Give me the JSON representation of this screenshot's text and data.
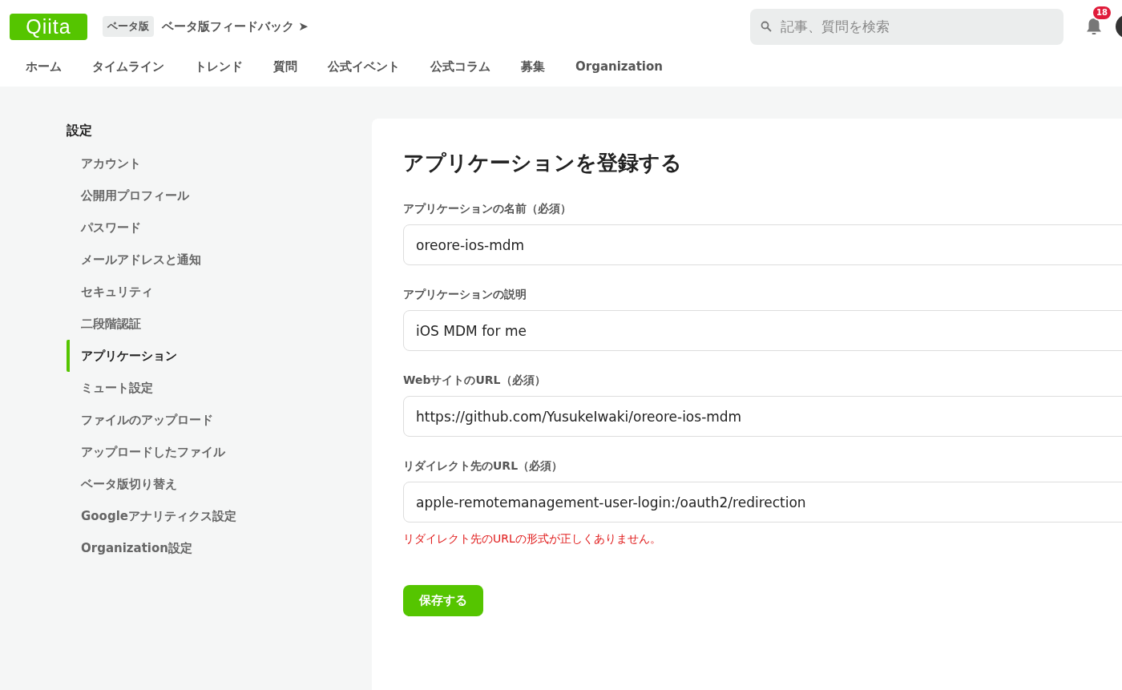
{
  "header": {
    "logo": "Qiita",
    "beta_badge": "ベータ版",
    "feedback_link": "ベータ版フィードバック",
    "feedback_arrow": "➤",
    "search": {
      "placeholder": "記事、質問を検索"
    },
    "notification_count": "18"
  },
  "nav": [
    "ホーム",
    "タイムライン",
    "トレンド",
    "質問",
    "公式イベント",
    "公式コラム",
    "募集",
    "Organization"
  ],
  "sidebar": {
    "title": "設定",
    "items": [
      {
        "label": "アカウント",
        "selected": false
      },
      {
        "label": "公開用プロフィール",
        "selected": false
      },
      {
        "label": "パスワード",
        "selected": false
      },
      {
        "label": "メールアドレスと通知",
        "selected": false
      },
      {
        "label": "セキュリティ",
        "selected": false
      },
      {
        "label": "二段階認証",
        "selected": false
      },
      {
        "label": "アプリケーション",
        "selected": true
      },
      {
        "label": "ミュート設定",
        "selected": false
      },
      {
        "label": "ファイルのアップロード",
        "selected": false
      },
      {
        "label": "アップロードしたファイル",
        "selected": false
      },
      {
        "label": "ベータ版切り替え",
        "selected": false
      },
      {
        "label": "Googleアナリティクス設定",
        "selected": false
      },
      {
        "label": "Organization設定",
        "selected": false
      }
    ]
  },
  "form": {
    "title": "アプリケーションを登録する",
    "fields": [
      {
        "label": "アプリケーションの名前（必須）",
        "value": "oreore-ios-mdm"
      },
      {
        "label": "アプリケーションの説明",
        "value": "iOS MDM for me"
      },
      {
        "label": "WebサイトのURL（必須）",
        "value": "https://github.com/YusukeIwaki/oreore-ios-mdm"
      },
      {
        "label": "リダイレクト先のURL（必須）",
        "value": "apple-remotemanagement-user-login:/oauth2/redirection",
        "error": "リダイレクト先のURLの形式が正しくありません。"
      }
    ],
    "submit": "保存する"
  }
}
